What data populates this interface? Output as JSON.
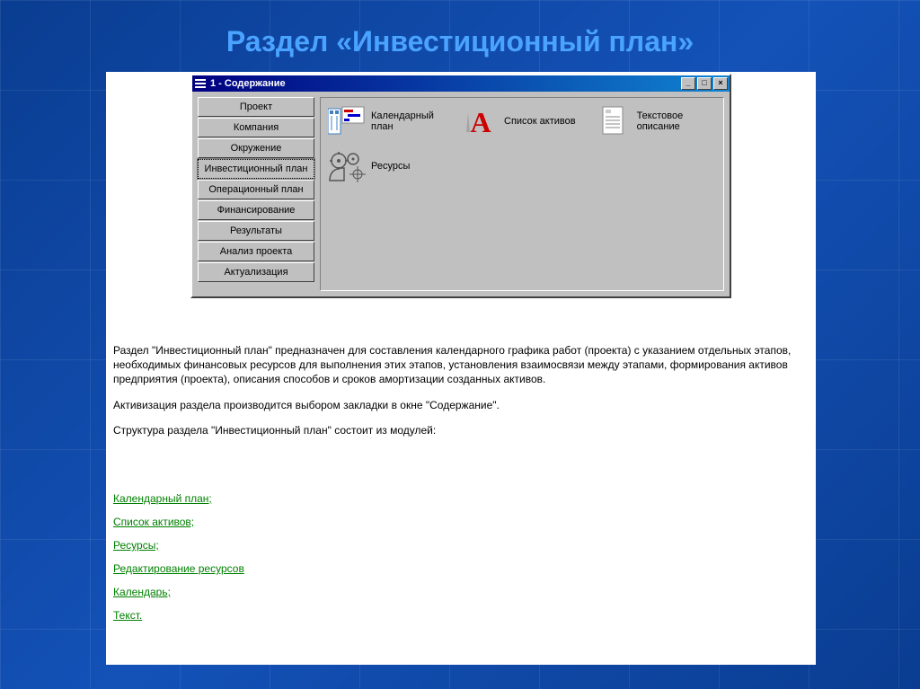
{
  "slideTitle": "Раздел «Инвестиционный план»",
  "window": {
    "title": "1 - Содержание",
    "tabs": [
      "Проект",
      "Компания",
      "Окружение",
      "Инвестиционный план",
      "Операционный план",
      "Финансирование",
      "Результаты",
      "Анализ проекта",
      "Актуализация"
    ],
    "activeTab": 3,
    "icons": {
      "calendar": "Календарный план",
      "assets": "Список активов",
      "textdesc": "Текстовое описание",
      "resources": "Ресурсы"
    }
  },
  "paragraphs": [
    "Раздел \"Инвестиционный план\" предназначен для составления календарного графика работ (проекта) с указанием отдельных этапов, необходимых финансовых ресурсов для выполнения этих этапов, установления взаимосвязи между этапами, формирования активов предприятия (проекта), описания способов и сроков амортизации созданных активов.",
    "Активизация раздела производится выбором закладки в окне \"Содержание\".",
    "Структура раздела \"Инвестиционный план\"  состоит из модулей:"
  ],
  "links": [
    "Календарный план;",
    "Список активов;",
    "Ресурсы;",
    "Редактирование ресурсов",
    "Календарь;",
    "Текст."
  ]
}
